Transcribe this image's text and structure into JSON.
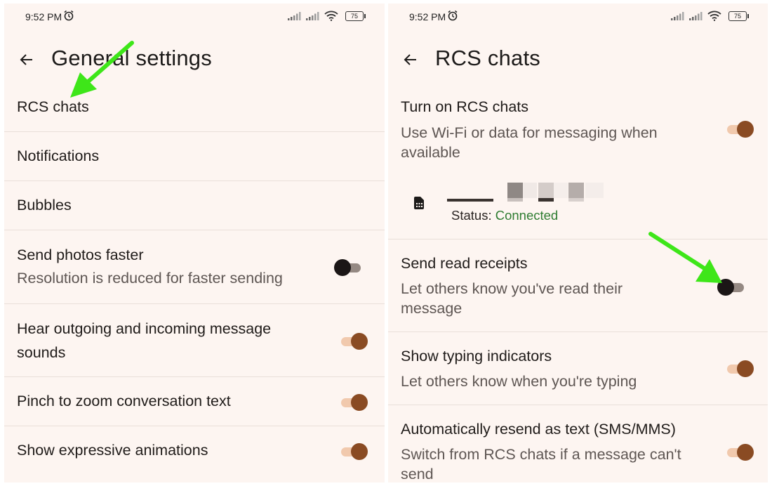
{
  "left_screen": {
    "status_bar": {
      "time": "9:52 PM",
      "battery": "75"
    },
    "title": "General settings",
    "items": [
      {
        "title": "RCS chats"
      },
      {
        "title": "Notifications"
      },
      {
        "title": "Bubbles"
      },
      {
        "title": "Send photos faster",
        "subtitle": "Resolution is reduced for faster sending",
        "toggle": false
      },
      {
        "title": "Hear outgoing and incoming message sounds",
        "toggle": true
      },
      {
        "title": "Pinch to zoom conversation text",
        "toggle": true
      },
      {
        "title": "Show expressive animations",
        "toggle": true
      }
    ]
  },
  "right_screen": {
    "status_bar": {
      "time": "9:52 PM",
      "battery": "75"
    },
    "title": "RCS chats",
    "items": [
      {
        "title": "Turn on RCS chats",
        "subtitle": "Use Wi-Fi or data for messaging when available",
        "toggle": true
      },
      {
        "title": "Send read receipts",
        "subtitle": "Let others know you've read their message",
        "toggle": false
      },
      {
        "title": "Show typing indicators",
        "subtitle": "Let others know when you're typing",
        "toggle": true
      },
      {
        "title": "Automatically resend as text (SMS/MMS)",
        "subtitle": "Switch from RCS chats if a message can't send",
        "toggle": true
      }
    ],
    "sim_status": {
      "label": "Status:",
      "value": "Connected"
    }
  },
  "colors": {
    "background": "#fdf5f1",
    "toggle_on_thumb": "#8a4b23",
    "toggle_on_track": "#f1c9ad",
    "toggle_off_thumb": "#1b1616",
    "toggle_off_track": "#958983",
    "status_connected": "#2f7d32",
    "annotation_arrow": "#3ee619"
  }
}
